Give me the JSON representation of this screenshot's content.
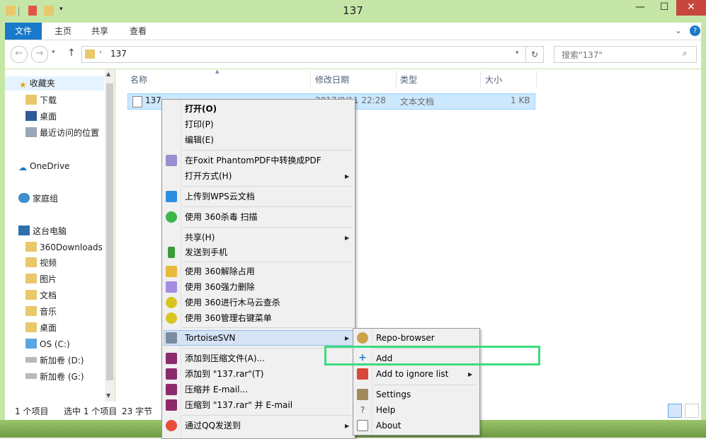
{
  "window": {
    "title": "137",
    "minimize": "—",
    "maximize": "☐",
    "close": "✕"
  },
  "ribbon": {
    "tabs": [
      "文件",
      "主页",
      "共享",
      "查看"
    ],
    "expand": "⌄",
    "help": "?"
  },
  "nav": {
    "back": "←",
    "forward": "→",
    "up": "↑",
    "path": "137",
    "refresh": "↻",
    "search_placeholder": "搜索\"137\""
  },
  "sidebar": {
    "favorites": "收藏夹",
    "fav_items": [
      "下载",
      "桌面",
      "最近访问的位置"
    ],
    "onedrive": "OneDrive",
    "homegroup": "家庭组",
    "thispc": "这台电脑",
    "pc_items": [
      "360Downloads",
      "视频",
      "图片",
      "文档",
      "音乐",
      "桌面",
      "OS (C:)",
      "新加卷 (D:)",
      "新加卷 (G:)"
    ]
  },
  "columns": {
    "name": "名称",
    "modified": "修改日期",
    "type": "类型",
    "size": "大小"
  },
  "file": {
    "name": "137",
    "modified": "2017/8/11 22:28",
    "type": "文本文档",
    "size": "1 KB"
  },
  "status": {
    "count": "1 个项目",
    "selected": "选中 1 个项目",
    "size": "23 字节"
  },
  "context_menu": {
    "open": "打开(O)",
    "print": "打印(P)",
    "edit": "编辑(E)",
    "foxit": "在Foxit PhantomPDF中转换成PDF",
    "open_with": "打开方式(H)",
    "wps": "上传到WPS云文档",
    "scan360": "使用 360杀毒 扫描",
    "share": "共享(H)",
    "send_phone": "发送到手机",
    "unlock360": "使用 360解除占用",
    "delete360": "使用 360强力删除",
    "trojan360": "使用 360进行木马云查杀",
    "rightmenu360": "使用 360管理右键菜单",
    "tortoise": "TortoiseSVN",
    "rar_add": "添加到压缩文件(A)...",
    "rar_add137": "添加到 \"137.rar\"(T)",
    "rar_email": "压缩并 E-mail...",
    "rar_email137": "压缩到 \"137.rar\" 并 E-mail",
    "qq": "通过QQ发送到"
  },
  "svn_menu": {
    "repo": "Repo-browser",
    "add": "Add",
    "ignore": "Add to ignore list",
    "settings": "Settings",
    "help": "Help",
    "about": "About"
  },
  "colors": {
    "accent": "#1979ca",
    "highlight": "#3ddb7e",
    "titlebar": "#c6e6a8"
  }
}
